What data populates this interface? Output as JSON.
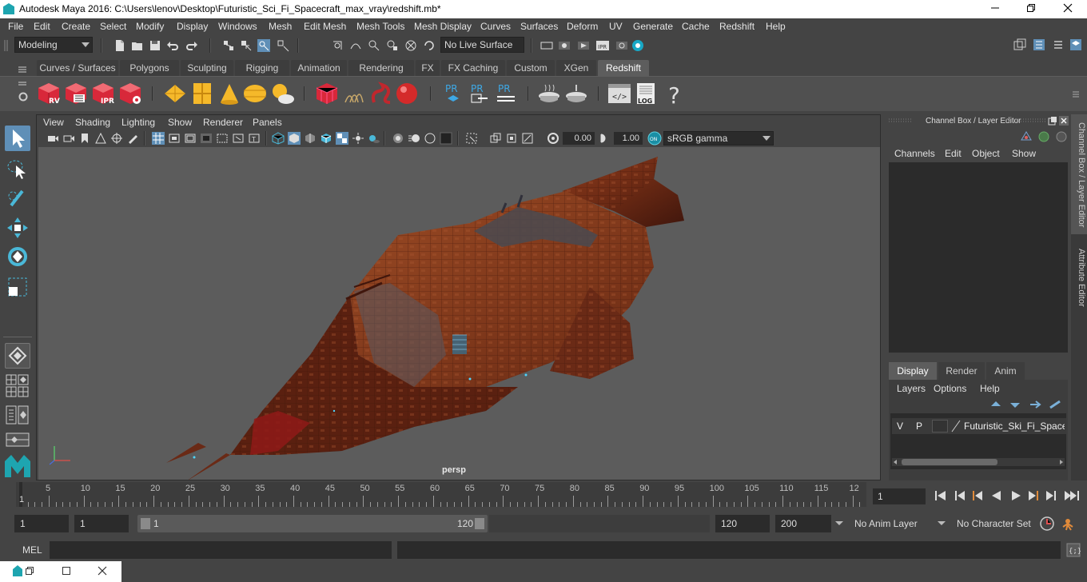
{
  "window": {
    "title": "Autodesk Maya 2016: C:\\Users\\lenov\\Desktop\\Futuristic_Sci_Fi_Spacecraft_max_vray\\redshift.mb*",
    "minimize_icon": "minimize-icon",
    "maximize_icon": "maximize-icon",
    "close_icon": "close-icon"
  },
  "menubar": [
    "File",
    "Edit",
    "Create",
    "Select",
    "Modify",
    "Display",
    "Windows",
    "Mesh",
    "Edit Mesh",
    "Mesh Tools",
    "Mesh Display",
    "Curves",
    "Surfaces",
    "Deform",
    "UV",
    "Generate",
    "Cache",
    "Redshift",
    "Help"
  ],
  "status": {
    "mode": "Modeling",
    "live_surface": "No Live Surface"
  },
  "shelf_tabs": [
    "Curves / Surfaces",
    "Polygons",
    "Sculpting",
    "Rigging",
    "Animation",
    "Rendering",
    "FX",
    "FX Caching",
    "Custom",
    "XGen",
    "Redshift"
  ],
  "shelf_active": "Redshift",
  "shelf_icon_labels": {
    "rv": "RV",
    "ipr": "IPR",
    "pr": "PR",
    "log": "LOG",
    "help": "?"
  },
  "viewport": {
    "menus": [
      "View",
      "Shading",
      "Lighting",
      "Show",
      "Renderer",
      "Panels"
    ],
    "exposure": "0.00",
    "gamma": "1.00",
    "color_space": "sRGB gamma",
    "camera_label": "persp"
  },
  "channel_box": {
    "title": "Channel Box / Layer Editor",
    "menus": [
      "Channels",
      "Edit",
      "Object",
      "Show"
    ]
  },
  "layer_editor": {
    "tabs": [
      "Display",
      "Render",
      "Anim"
    ],
    "active_tab": "Display",
    "menus": [
      "Layers",
      "Options",
      "Help"
    ],
    "layer": {
      "v": "V",
      "p": "P",
      "name": "Futuristic_Ski_Fi_Spacecr"
    }
  },
  "side_tabs": [
    "Channel Box / Layer Editor",
    "Attribute Editor"
  ],
  "timeline": {
    "ticks": [
      "5",
      "10",
      "15",
      "20",
      "25",
      "30",
      "35",
      "40",
      "45",
      "50",
      "55",
      "60",
      "65",
      "70",
      "75",
      "80",
      "85",
      "90",
      "95",
      "100",
      "105",
      "110",
      "115",
      "12"
    ],
    "current_frame_marker": "1",
    "current_frame": "1"
  },
  "range": {
    "start": "1",
    "playback_start": "1",
    "slider_start": "1",
    "slider_end": "120",
    "playback_end": "120",
    "end": "200",
    "anim_layer": "No Anim Layer",
    "character_set": "No Character Set"
  },
  "command": {
    "label": "MEL"
  }
}
